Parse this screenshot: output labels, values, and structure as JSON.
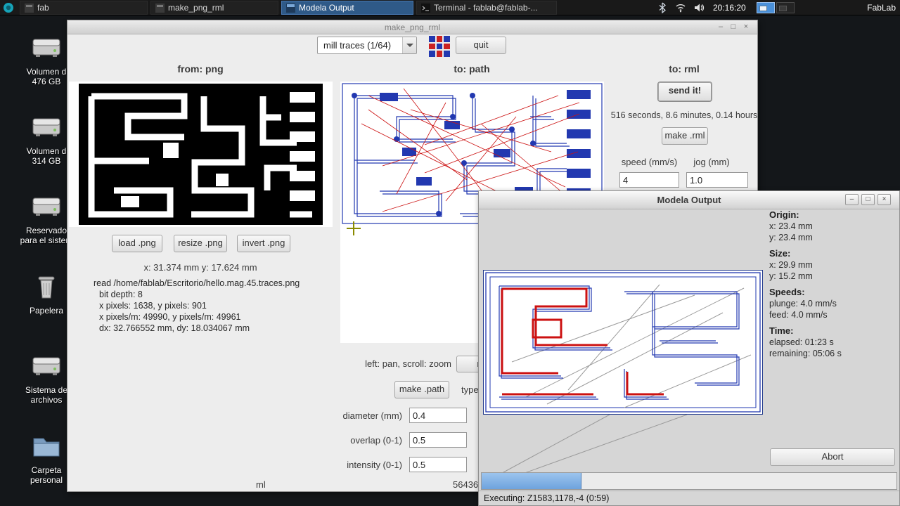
{
  "colors": {
    "accent_blue": "#2f5a88",
    "path_blue": "#2238b0",
    "trace_red": "#cc1111",
    "progress_fill": "#6ea3dd"
  },
  "panel": {
    "tasks": [
      {
        "label": "fab",
        "active": false
      },
      {
        "label": "make_png_rml",
        "active": false
      },
      {
        "label": "Modela Output",
        "active": true
      },
      {
        "label": "Terminal - fablab@fablab-...",
        "active": false
      }
    ],
    "clock": "20:16:20",
    "host_label": "FabLab"
  },
  "desktop": {
    "icons": [
      {
        "kind": "drive",
        "lines": [
          "Volumen d",
          "476 GB"
        ]
      },
      {
        "kind": "drive",
        "lines": [
          "Volumen d",
          "314 GB"
        ]
      },
      {
        "kind": "drive",
        "lines": [
          "Reservado",
          "para el sistem"
        ]
      },
      {
        "kind": "trash",
        "lines": [
          "Papelera",
          ""
        ]
      },
      {
        "kind": "drive",
        "lines": [
          "Sistema de",
          "archivos"
        ]
      },
      {
        "kind": "folder",
        "lines": [
          "Carpeta",
          "personal"
        ]
      }
    ]
  },
  "fab_window": {
    "title": "make_png_rml",
    "toolbar": {
      "process": "mill traces (1/64)",
      "quit": "quit"
    },
    "headers": {
      "png": "from: png",
      "path": "to: path",
      "rml": "to: rml"
    },
    "png": {
      "load": "load .png",
      "resize": "resize .png",
      "invert": "invert .png",
      "coords": "x: 31.374 mm  y: 17.624 mm",
      "info": [
        "read /home/fablab/Escritorio/hello.mag.45.traces.png",
        "bit depth: 8",
        "x pixels: 1638, y pixels: 901",
        "x pixels/m: 49990, y pixels/m: 49961",
        "dx: 32.766552 mm, dy: 18.034067 mm"
      ]
    },
    "path": {
      "hint": "left: pan, scroll: zoom",
      "reset": "rese",
      "make_path": "make .path",
      "type_label": "type:",
      "fields": [
        {
          "label": "diameter (mm)",
          "value": "0.4"
        },
        {
          "label": "overlap (0-1)",
          "value": "0.5"
        },
        {
          "label": "intensity (0-1)",
          "value": "0.5"
        }
      ]
    },
    "rml": {
      "send": "send it!",
      "estimate": "516 seconds, 8.6 minutes, 0.14 hours",
      "make_rml": "make .rml",
      "speed_label": "speed (mm/s)",
      "jog_label": "jog (mm)",
      "speed": "4",
      "jog": "1.0"
    },
    "bottom": {
      "left_text": "ml",
      "right_text": "56436"
    }
  },
  "modela": {
    "title": "Modela Output",
    "info": [
      {
        "h": "Origin:",
        "lines": [
          "x: 23.4 mm",
          "y: 23.4 mm"
        ]
      },
      {
        "h": "Size:",
        "lines": [
          "x: 29.9 mm",
          "y: 15.2 mm"
        ]
      },
      {
        "h": "Speeds:",
        "lines": [
          "plunge: 4.0 mm/s",
          "feed: 4.0 mm/s"
        ]
      },
      {
        "h": "Time:",
        "lines": [
          "elapsed: 01:23 s",
          "remaining: 05:06 s"
        ]
      }
    ],
    "abort": "Abort",
    "status": "Executing: Z1583,1178,-4 (0:59)",
    "progress_percent": 24
  }
}
